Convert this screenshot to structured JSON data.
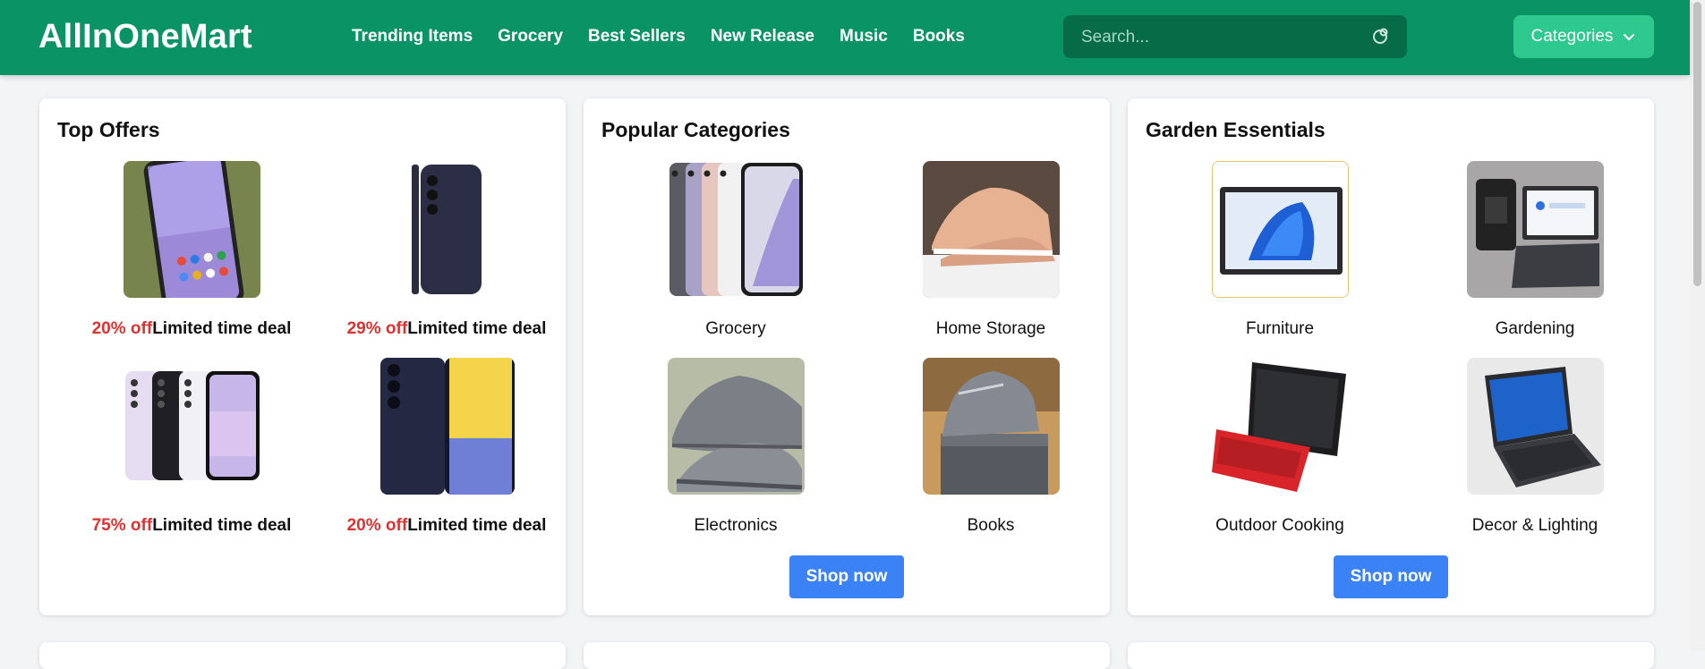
{
  "header": {
    "brand": "AllInOneMart",
    "nav": [
      "Trending Items",
      "Grocery",
      "Best Sellers",
      "New Release",
      "Music",
      "Books"
    ],
    "search_placeholder": "Search...",
    "categories_button": "Categories",
    "icons": {
      "search": "search-icon",
      "dropdown": "chevron-down-icon"
    }
  },
  "colors": {
    "header_bg": "#0a9466",
    "search_bg": "#066c47",
    "categories_bg": "#2ec98e",
    "shop_button": "#3b82f6",
    "discount": "#e03131",
    "page_bg": "#f3f4f6"
  },
  "cards": [
    {
      "title": "Top Offers",
      "items": [
        {
          "discount": "20% off",
          "deal": "Limited time deal",
          "image": "phone-front-image"
        },
        {
          "discount": "29% off",
          "deal": "Limited time deal",
          "image": "phone-side-image"
        },
        {
          "discount": "75% off",
          "deal": "Limited time deal",
          "image": "phones-lineup-image"
        },
        {
          "discount": "20% off",
          "deal": "Limited time deal",
          "image": "galaxy-a15-image"
        }
      ]
    },
    {
      "title": "Popular Categories",
      "items": [
        {
          "label": "Grocery",
          "image": "phone-colors-image"
        },
        {
          "label": "Home Storage",
          "image": "pink-sneakers-image"
        },
        {
          "label": "Electronics",
          "image": "grey-sneakers-image"
        },
        {
          "label": "Books",
          "image": "sneaker-box-image"
        }
      ],
      "button": "Shop now"
    },
    {
      "title": "Garden Essentials",
      "items": [
        {
          "label": "Furniture",
          "image": "tablet-image"
        },
        {
          "label": "Gardening",
          "image": "laptop-bag-image"
        },
        {
          "label": "Outdoor Cooking",
          "image": "red-keyboard-tablet-image"
        },
        {
          "label": "Decor & Lighting",
          "image": "surface-tablet-image"
        }
      ],
      "button": "Shop now"
    }
  ]
}
